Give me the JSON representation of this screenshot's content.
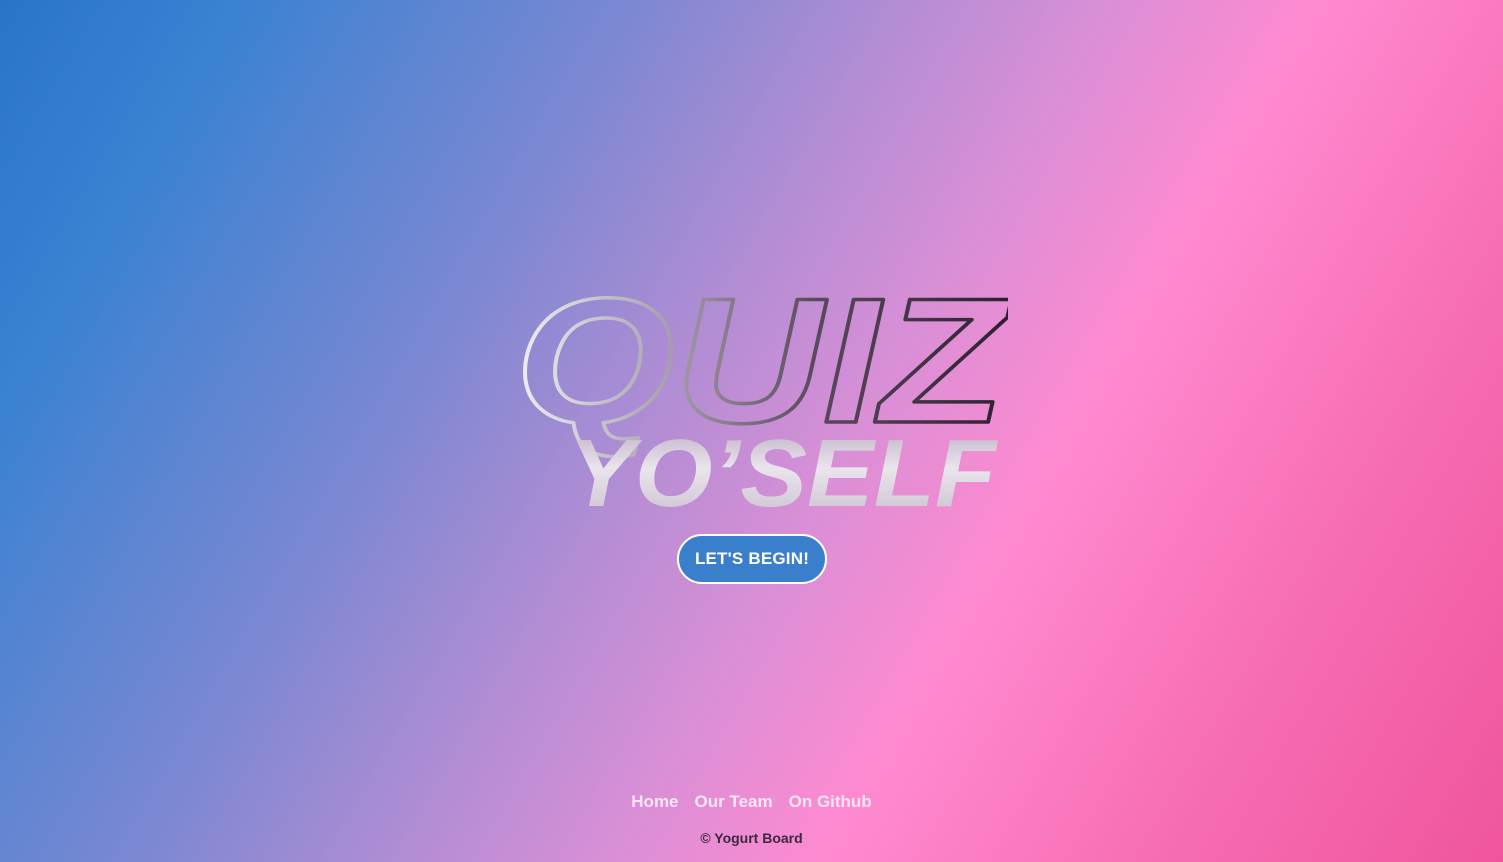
{
  "logo": {
    "line1": "QUIZ",
    "line2": "YO’SELF"
  },
  "hero": {
    "begin_label": "LET'S BEGIN!"
  },
  "footer": {
    "links": [
      {
        "label": "Home"
      },
      {
        "label": "Our Team"
      },
      {
        "label": "On Github"
      }
    ],
    "copyright": "© Yogurt Board"
  },
  "colors": {
    "button_bg": "#3a7fcc",
    "gradient_start": "#2a74c8",
    "gradient_mid": "#ff8ad0",
    "gradient_end": "#ef559c"
  }
}
